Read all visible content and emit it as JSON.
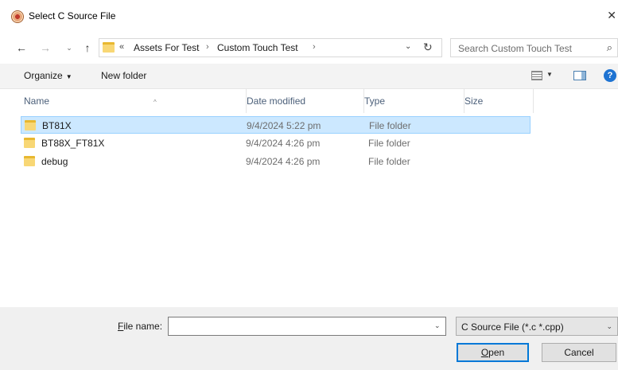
{
  "window": {
    "title": "Select C Source File",
    "close_glyph": "✕"
  },
  "nav": {
    "back_glyph": "←",
    "forward_glyph": "→",
    "recent_glyph": "⌄",
    "up_glyph": "↑",
    "overflow_glyph": "«",
    "breadcrumbs": [
      "Assets For Test",
      "Custom Touch Test"
    ],
    "separator_glyph": "›",
    "dropdown_glyph": "⌄",
    "refresh_glyph": "↻",
    "search_placeholder": "Search Custom Touch Test",
    "search_glyph": "⌕"
  },
  "toolbar": {
    "organize_label": "Organize",
    "organize_caret": "▼",
    "new_folder_label": "New folder",
    "view_caret": "▼",
    "help_glyph": "?"
  },
  "columns": {
    "name": "Name",
    "sort_caret": "^",
    "date_modified": "Date modified",
    "type": "Type",
    "size": "Size"
  },
  "files": [
    {
      "name": "BT81X",
      "date": "9/4/2024 5:22 pm",
      "type": "File folder",
      "size": "",
      "selected": true
    },
    {
      "name": "BT88X_FT81X",
      "date": "9/4/2024 4:26 pm",
      "type": "File folder",
      "size": "",
      "selected": false
    },
    {
      "name": "debug",
      "date": "9/4/2024 4:26 pm",
      "type": "File folder",
      "size": "",
      "selected": false
    }
  ],
  "footer": {
    "file_name_label": "File name:",
    "file_name_value": "",
    "file_name_caret": "⌄",
    "filter_label": "C Source File (*.c *.cpp)",
    "filter_caret": "⌄",
    "open_label": "Open",
    "cancel_label": "Cancel"
  },
  "colors": {
    "selection_bg": "#cce8ff",
    "selection_border": "#99d1ff",
    "folder": "#f8d775",
    "primary_button_border": "#0078d7",
    "help_icon": "#1e73d2"
  }
}
